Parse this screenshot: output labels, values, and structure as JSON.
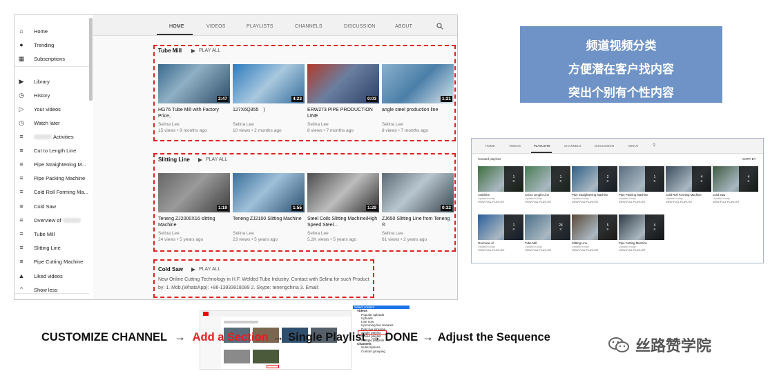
{
  "sidebar": {
    "items": [
      {
        "icon": "home-icon",
        "label": "Home"
      },
      {
        "icon": "trending-icon",
        "label": "Trending"
      },
      {
        "icon": "subscriptions-icon",
        "label": "Subscriptions"
      },
      {
        "icon": "library-icon",
        "label": "Library"
      },
      {
        "icon": "history-icon",
        "label": "History"
      },
      {
        "icon": "your-videos-icon",
        "label": "Your videos"
      },
      {
        "icon": "watch-later-icon",
        "label": "Watch later"
      },
      {
        "icon": "playlist-icon",
        "label": "Activities"
      },
      {
        "icon": "playlist-icon",
        "label": "Cut to Length Line"
      },
      {
        "icon": "playlist-icon",
        "label": "Pipe Straightening M..."
      },
      {
        "icon": "playlist-icon",
        "label": "Pipe Packing Machine"
      },
      {
        "icon": "playlist-icon",
        "label": "Cold Roll Forming Ma..."
      },
      {
        "icon": "playlist-icon",
        "label": "Cold Saw"
      },
      {
        "icon": "playlist-icon",
        "label": "Overview of"
      },
      {
        "icon": "playlist-icon",
        "label": "Tube Mill"
      },
      {
        "icon": "playlist-icon",
        "label": "Slitting Line"
      },
      {
        "icon": "playlist-icon",
        "label": "Pipe Cutting Machine"
      },
      {
        "icon": "liked-icon",
        "label": "Liked videos"
      },
      {
        "icon": "chevron-up-icon",
        "label": "Show less"
      }
    ]
  },
  "tabs": [
    "HOME",
    "VIDEOS",
    "PLAYLISTS",
    "CHANNELS",
    "DISCUSSION",
    "ABOUT"
  ],
  "sections": [
    {
      "title": "Tube Mill",
      "play_all": "PLAY ALL",
      "videos": [
        {
          "title": "HG76 Tube Mill with Factory Price,",
          "channel": "Selina Lee",
          "meta": "15 views • 9 months ago",
          "duration": "2:47"
        },
        {
          "title": "127X6Q355　)",
          "channel": "Selina Lee",
          "meta": "10 views • 2 months ago",
          "duration": "4:23"
        },
        {
          "title": "ERW273 PIPE PRODUCTION LINE",
          "channel": "Selina Lee",
          "meta": "8 views • 7 months ago",
          "duration": "0:03"
        },
        {
          "title": "angle steel production line",
          "channel": "Selina Lee",
          "meta": "8 views • 7 months ago",
          "duration": "1:21"
        }
      ]
    },
    {
      "title": "Slitting Line",
      "play_all": "PLAY ALL",
      "videos": [
        {
          "title": "Teneng ZJ2000X16 slitting Machine",
          "channel": "Selina Lee",
          "meta": "24 views • 5 years ago",
          "duration": "1:19"
        },
        {
          "title": "Teneng ZJ2100 Slitting Machine",
          "channel": "Selina Lee",
          "meta": "23 views • 5 years ago",
          "duration": "1:55"
        },
        {
          "title": "Steel Coils Slitting Machine/High Speed Steel...",
          "channel": "Selina Lee",
          "meta": "5.2K views • 5 years ago",
          "duration": "1:29"
        },
        {
          "title": "ZJ650 Slitting Line from Teneng ®",
          "channel": "Selina Lee",
          "meta": "61 views • 2 years ago",
          "duration": "0:32"
        }
      ]
    },
    {
      "title": "Cold Saw",
      "play_all": "PLAY ALL",
      "description": "New Online Cutting Technology in H.F. Welded Tube Industry, Contact with Selina for such Product by: 1. Mob.(WhatsApp): +86-13933818089 2. Skype: tenengchina 3. Email:"
    }
  ],
  "bluebox": {
    "lines": [
      "频道视频分类",
      "方便潜在客户找内容",
      "突出个别有个性内容"
    ]
  },
  "right_shot": {
    "tabs": [
      "HOME",
      "VIDEOS",
      "PLAYLISTS",
      "CHANNELS",
      "DISCUSSION",
      "ABOUT"
    ],
    "created_label": "Created playlists",
    "sort_label": "SORT BY",
    "updated": "Updated today",
    "view_full": "VIEW FULL PLAYLIST",
    "playlists": [
      {
        "title": "Activities",
        "count": "1"
      },
      {
        "title": "Cut to Length Line",
        "count": "1"
      },
      {
        "title": "Pipe Straightening Machine",
        "count": "2"
      },
      {
        "title": "Pipe Packing Machine",
        "count": "1"
      },
      {
        "title": "Cold Roll Forming Machine",
        "count": "4"
      },
      {
        "title": "Cold Saw",
        "count": "4"
      },
      {
        "title": "Overview of",
        "count": "1"
      },
      {
        "title": "Tube Mill",
        "count": "24"
      },
      {
        "title": "Slitting Line",
        "count": "5"
      },
      {
        "title": "Pipe Cutting Machine",
        "count": "4"
      }
    ]
  },
  "flow": {
    "step1": "CUSTOMIZE CHANNEL",
    "arrow1": "→",
    "step2": "Add a Section",
    "arrow2": "→",
    "step3": "Single Playlist",
    "arrow3": "→",
    "step4": "DONE",
    "arrow4": "→",
    "step5": "Adjust the Sequence"
  },
  "menu": {
    "items": [
      "Select content",
      "Videos",
      "Popular uploads",
      "Uploads",
      "Live now",
      "Upcoming live streams",
      "Past live streams",
      "Single playlist",
      "Saved playlist",
      "Multiple playlists",
      "Channels",
      "Subscriptions",
      "Custom grouping"
    ]
  },
  "watermark": "丝路赞学院"
}
